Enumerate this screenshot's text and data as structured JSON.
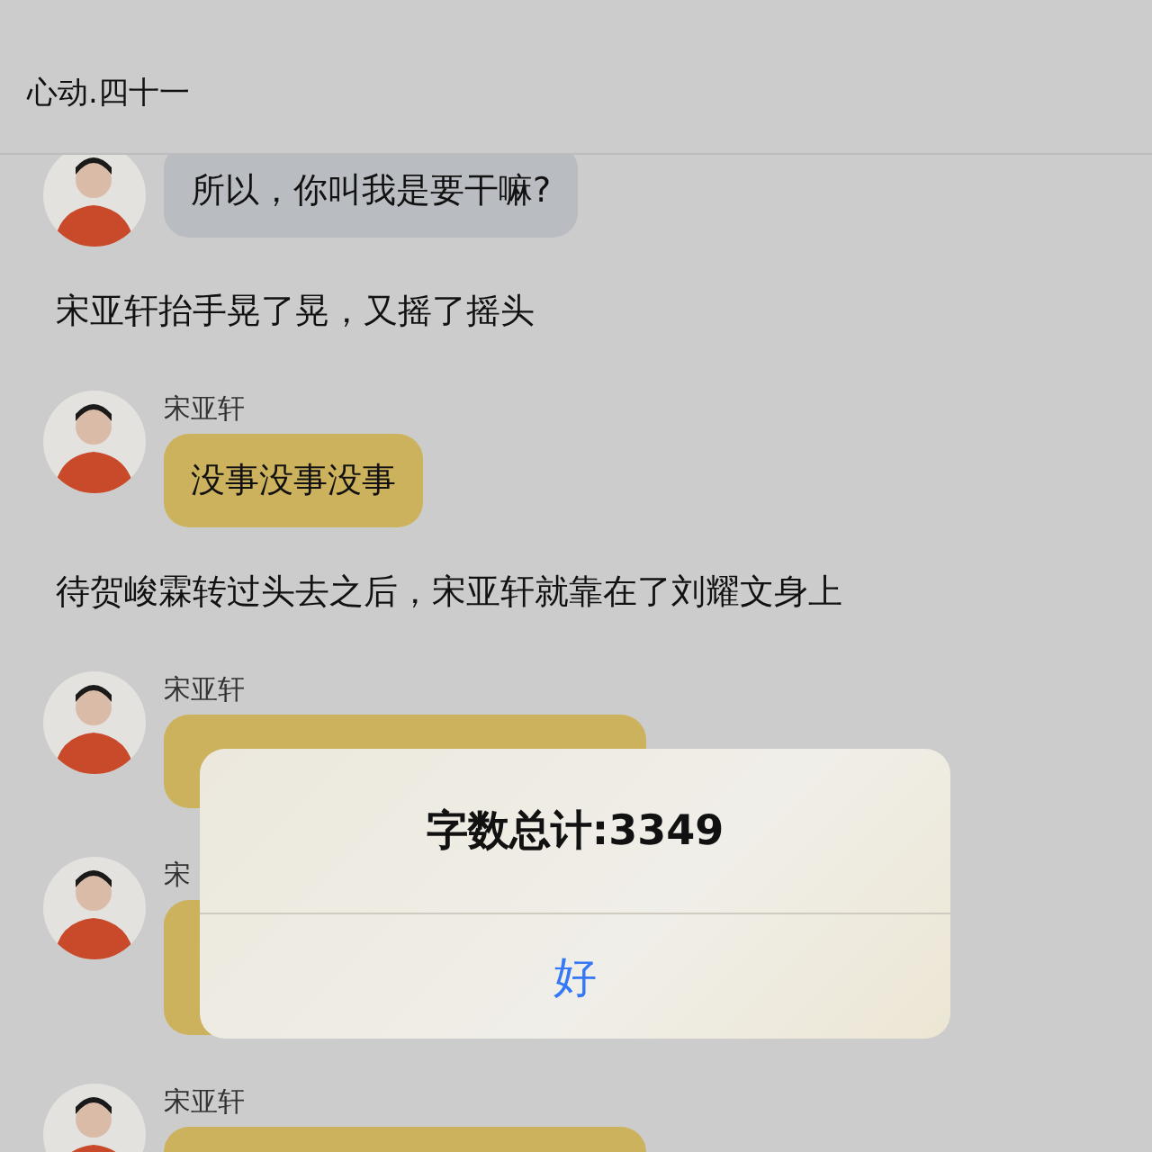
{
  "header": {
    "title": "心动.四十一"
  },
  "items": [
    {
      "kind": "message",
      "color": "#b9bcc1",
      "text": "所以，你叫我是要干嘛?"
    },
    {
      "kind": "narration",
      "text": "宋亚轩抬手晃了晃，又摇了摇头"
    },
    {
      "kind": "message",
      "name": "宋亚轩",
      "color": "#cdb25e",
      "text": "没事没事没事"
    },
    {
      "kind": "narration",
      "text": "待贺峻霖转过头去之后，宋亚轩就靠在了刘耀文身上"
    },
    {
      "kind": "message",
      "name": "宋亚轩",
      "color": "#cdb25e"
    },
    {
      "kind": "message",
      "name": "宋",
      "color": "#cdb25e",
      "tall": true
    },
    {
      "kind": "message",
      "name": "宋亚轩",
      "color": "#cdb25e"
    }
  ],
  "alert": {
    "title": "字数总计:3349",
    "button": "好"
  }
}
